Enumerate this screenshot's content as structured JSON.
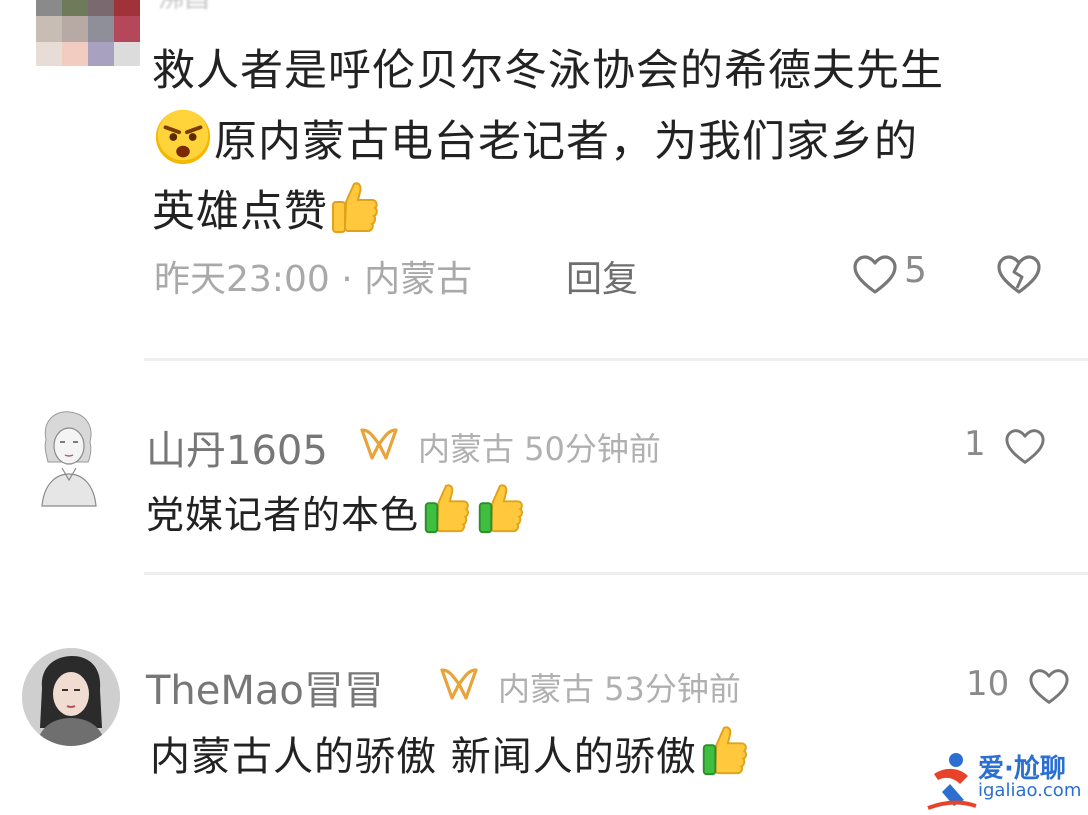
{
  "comments": [
    {
      "username": "沸昌",
      "text_line1": "救人者是呼伦贝尔冬泳协会的希德夫先生",
      "text_line2": "原内蒙古电台老记者，为我们家乡的",
      "text_line3": "英雄点赞",
      "emoji_1": "angry-face-emoji",
      "emoji_2": "thumbs-up-emoji",
      "meta": "昨天23:00 · 内蒙古",
      "reply_label": "回复",
      "like_count": "5",
      "like_icon": "heart-outline-icon",
      "dislike_icon": "broken-heart-icon"
    },
    {
      "username": "山丹1605",
      "badge_icon": "ribbon-badge-icon",
      "meta": "内蒙古 50分钟前",
      "like_count": "1",
      "text": "党媒记者的本色",
      "emojis": [
        "thumbs-up-emoji",
        "thumbs-up-emoji"
      ]
    },
    {
      "username": "TheMao冒冒",
      "badge_icon": "ribbon-badge-icon",
      "meta": "内蒙古 53分钟前",
      "like_count": "10",
      "text": "内蒙古人的骄傲 新闻人的骄傲",
      "emojis": [
        "thumbs-up-emoji"
      ]
    }
  ],
  "watermark": {
    "brand": "爱·尬聊",
    "url": "igaliao.com"
  },
  "colors": {
    "text": "#222222",
    "meta": "#a9a9a9",
    "badge": "#e8a33a",
    "divider": "#eeeeee",
    "watermark": "#2a6fd1"
  }
}
